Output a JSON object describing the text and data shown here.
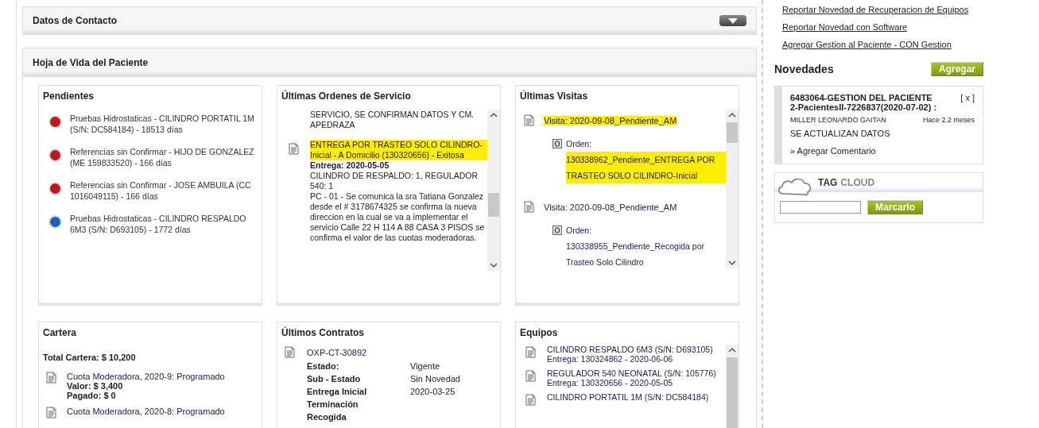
{
  "contact_section": {
    "title": "Datos de Contacto"
  },
  "patient_section": {
    "title": "Hoja de Vida del Paciente",
    "pending": {
      "title": "Pendientes",
      "items": [
        {
          "text": "Pruebas Hidrostaticas - CILINDRO PORTATIL 1M (S/N: DC584184) - 18513 días",
          "color": "#c0161c"
        },
        {
          "text": "Referencias sin Confirmar - HIJO DE GONZALEZ (ME 159833520) - 166 días",
          "color": "#c0161c"
        },
        {
          "text": "Referencias sin Confirmar - JOSE AMBUILA (CC 1016049115) - 166 días",
          "color": "#c0161c"
        },
        {
          "text": "Pruebas Hidrostaticas - CILINDRO RESPALDO 6M3 (S/N: D693105) - 1772 días",
          "color": "#1c5fc4"
        }
      ]
    },
    "orders": {
      "title": "Últimas Ordenes de Servicio",
      "items": [
        {
          "kind": "continued",
          "lines": [
            "SERVICIO, SE CONFIRMAN DATOS Y CM. APEDRAZA"
          ]
        },
        {
          "kind": "order",
          "title": "ENTREGA POR TRASTEO SOLO CILINDRO-Inicial - A Domicilio (130320656) - Exitosa",
          "highlighted": true,
          "delivery": "Entrega: 2020-05-05",
          "lines": [
            "CILINDRO DE RESPALDO: 1, REGULADOR 540: 1",
            "PC - 01 - Se comunica la sra Tatiana Gonzalez desde el # 3178674325 se confirma la nueva direccion en la cual se va a implementar el servicio Calle 22 H 114 A 88 CASA 3 PISOS se confirma el valor de las cuotas moderadoras."
          ]
        }
      ]
    },
    "visits": {
      "title": "Últimas Visitas",
      "items": [
        {
          "title": "Visita: 2020-09-08_Pendiente_AM",
          "highlighted": true,
          "order_label": "Orden:",
          "order": "130338962_Pendiente_ENTREGA POR TRASTEO SOLO CILINDRO-Inicial",
          "order_highlighted": true
        },
        {
          "title": "Visita: 2020-09-08_Pendiente_AM",
          "highlighted": false,
          "order_label": "Orden:",
          "order": "130338955_Pendiente_Recogida por Trasteo Solo Cilindro",
          "order_highlighted": false
        }
      ]
    },
    "portfolio": {
      "title": "Cartera",
      "total": "Total Cartera: $ 10,200",
      "items": [
        {
          "title": "Cuota Moderadora, 2020-9: Programado",
          "value": "Valor: $ 3,400",
          "paid": "Pagado: $ 0"
        },
        {
          "title": "Cuota Moderadora, 2020-8: Programado"
        }
      ]
    },
    "contracts": {
      "title": "Últimos Contratos",
      "code": "OXP-CT-30892",
      "fields": [
        {
          "label": "Estado:",
          "value": "Vigente"
        },
        {
          "label": "Sub - Estado",
          "value": "Sin Novedad"
        },
        {
          "label": "Entrega Inicial",
          "value": "2020-03-25"
        },
        {
          "label": "Terminación"
        },
        {
          "label": "Recogida"
        }
      ]
    },
    "equipment": {
      "title": "Equipos",
      "items": [
        {
          "name": "CILINDRO RESPALDO 6M3 (S/N: D693105)",
          "delivery": "Entrega: 130324862 - 2020-06-06"
        },
        {
          "name": "REGULADOR 540 NEONATAL (S/N: 105776)",
          "delivery": "Entrega: 130320656 - 2020-05-05"
        },
        {
          "name": "CILINDRO PORTATIL 1M (S/N: DC584184)"
        }
      ]
    }
  },
  "links": [
    "Reportar Novedad de Recuperacion de Equipos",
    "Reportar Novedad con Software",
    "Agregar Gestion al Paciente - CON Gestion"
  ],
  "news": {
    "title": "Novedades",
    "add_button": "Agregar",
    "items": [
      {
        "title": "6483064-GESTION DEL PACIENTE 2-PacientesII-7226837(2020-07-02) :",
        "close": "[ x ]",
        "author": "MILLER LEONARDO GAITAN",
        "time": "Hace 2.2 meses",
        "body": "SE ACTUALIZAN DATOS",
        "comment_link": "» Agregar Comentario"
      }
    ]
  },
  "tag_cloud": {
    "title_main": "TAG",
    "title_sub": "CLOUD",
    "button": "Marcarlo"
  }
}
